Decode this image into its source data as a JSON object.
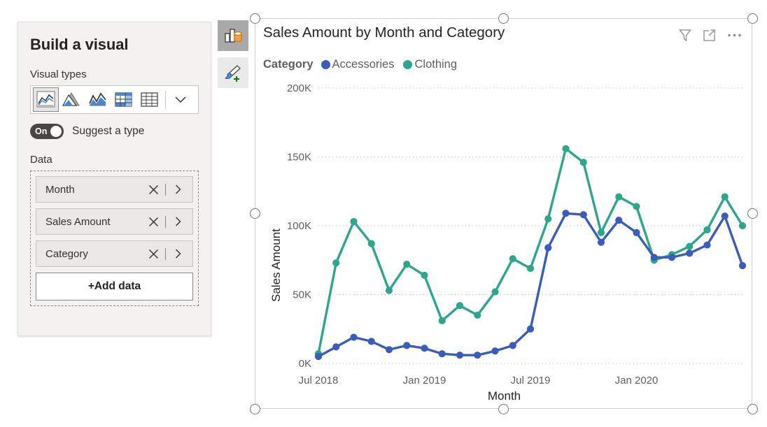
{
  "build_pane": {
    "title": "Build a visual",
    "visual_types_label": "Visual types",
    "visual_types": [
      {
        "name": "line-and-stacked-column-chart",
        "selected": true
      },
      {
        "name": "area-chart",
        "selected": false
      },
      {
        "name": "line-chart",
        "selected": false
      },
      {
        "name": "matrix-visual",
        "selected": false
      },
      {
        "name": "table-visual",
        "selected": false
      }
    ],
    "more_types_chevron": "chevron-down-icon",
    "suggest_toggle": {
      "state_text": "On",
      "label": "Suggest a type",
      "enabled": true
    },
    "data_label": "Data",
    "fields": [
      {
        "name": "Month"
      },
      {
        "name": "Sales Amount"
      },
      {
        "name": "Category"
      }
    ],
    "add_data_label": "+Add data"
  },
  "rail": {
    "buttons": [
      {
        "name": "build-visual-icon",
        "active": true
      },
      {
        "name": "format-visual-icon",
        "active": false
      }
    ]
  },
  "visual": {
    "title": "Sales Amount by Month and Category",
    "header_icons": [
      {
        "name": "filter-icon"
      },
      {
        "name": "focus-mode-icon"
      },
      {
        "name": "more-options-icon"
      }
    ],
    "legend": {
      "title": "Category",
      "items": [
        {
          "label": "Accessories",
          "color": "#3b5cb8"
        },
        {
          "label": "Clothing",
          "color": "#2ea68c"
        }
      ]
    }
  },
  "colors": {
    "accessories": "#3b5cb8",
    "clothing": "#2ea68c",
    "gridline": "#b3b3b3",
    "pane_bg": "#f3f2f1",
    "text": "#252423",
    "muted_text": "#605e5c"
  },
  "chart_data": {
    "type": "line",
    "title": "Sales Amount by Month and Category",
    "xlabel": "Month",
    "ylabel": "Sales Amount",
    "ylim": [
      0,
      200000
    ],
    "ytick_labels": [
      "0K",
      "50K",
      "100K",
      "150K",
      "200K"
    ],
    "ytick_values": [
      0,
      50000,
      100000,
      150000,
      200000
    ],
    "xtick_labels": [
      "Jul 2018",
      "Jan 2019",
      "Jul 2019",
      "Jan 2020"
    ],
    "xtick_indices": [
      0,
      6,
      12,
      18
    ],
    "grid": true,
    "legend_position": "top",
    "x": [
      "Jul 2018",
      "Aug 2018",
      "Sep 2018",
      "Oct 2018",
      "Nov 2018",
      "Dec 2018",
      "Jan 2019",
      "Feb 2019",
      "Mar 2019",
      "Apr 2019",
      "May 2019",
      "Jun 2019",
      "Jul 2019",
      "Aug 2019",
      "Sep 2019",
      "Oct 2019",
      "Nov 2019",
      "Dec 2019",
      "Jan 2020",
      "Feb 2020",
      "Mar 2020",
      "Apr 2020",
      "May 2020",
      "Jun 2020",
      "Jul 2020"
    ],
    "series": [
      {
        "name": "Accessories",
        "color": "#3b5cb8",
        "values": [
          5000,
          12000,
          19000,
          16000,
          10000,
          13000,
          11000,
          7000,
          6000,
          6000,
          9000,
          13000,
          25000,
          84000,
          109000,
          108000,
          88000,
          104000,
          95000,
          77000,
          77000,
          80000,
          86000,
          107000,
          71000
        ]
      },
      {
        "name": "Clothing",
        "color": "#2ea68c",
        "values": [
          7000,
          73000,
          103000,
          87000,
          53000,
          72000,
          64000,
          31000,
          42000,
          35000,
          52000,
          76000,
          69000,
          105000,
          156000,
          146000,
          95000,
          121000,
          114000,
          75000,
          79000,
          85000,
          97000,
          121000,
          100000
        ]
      }
    ]
  }
}
